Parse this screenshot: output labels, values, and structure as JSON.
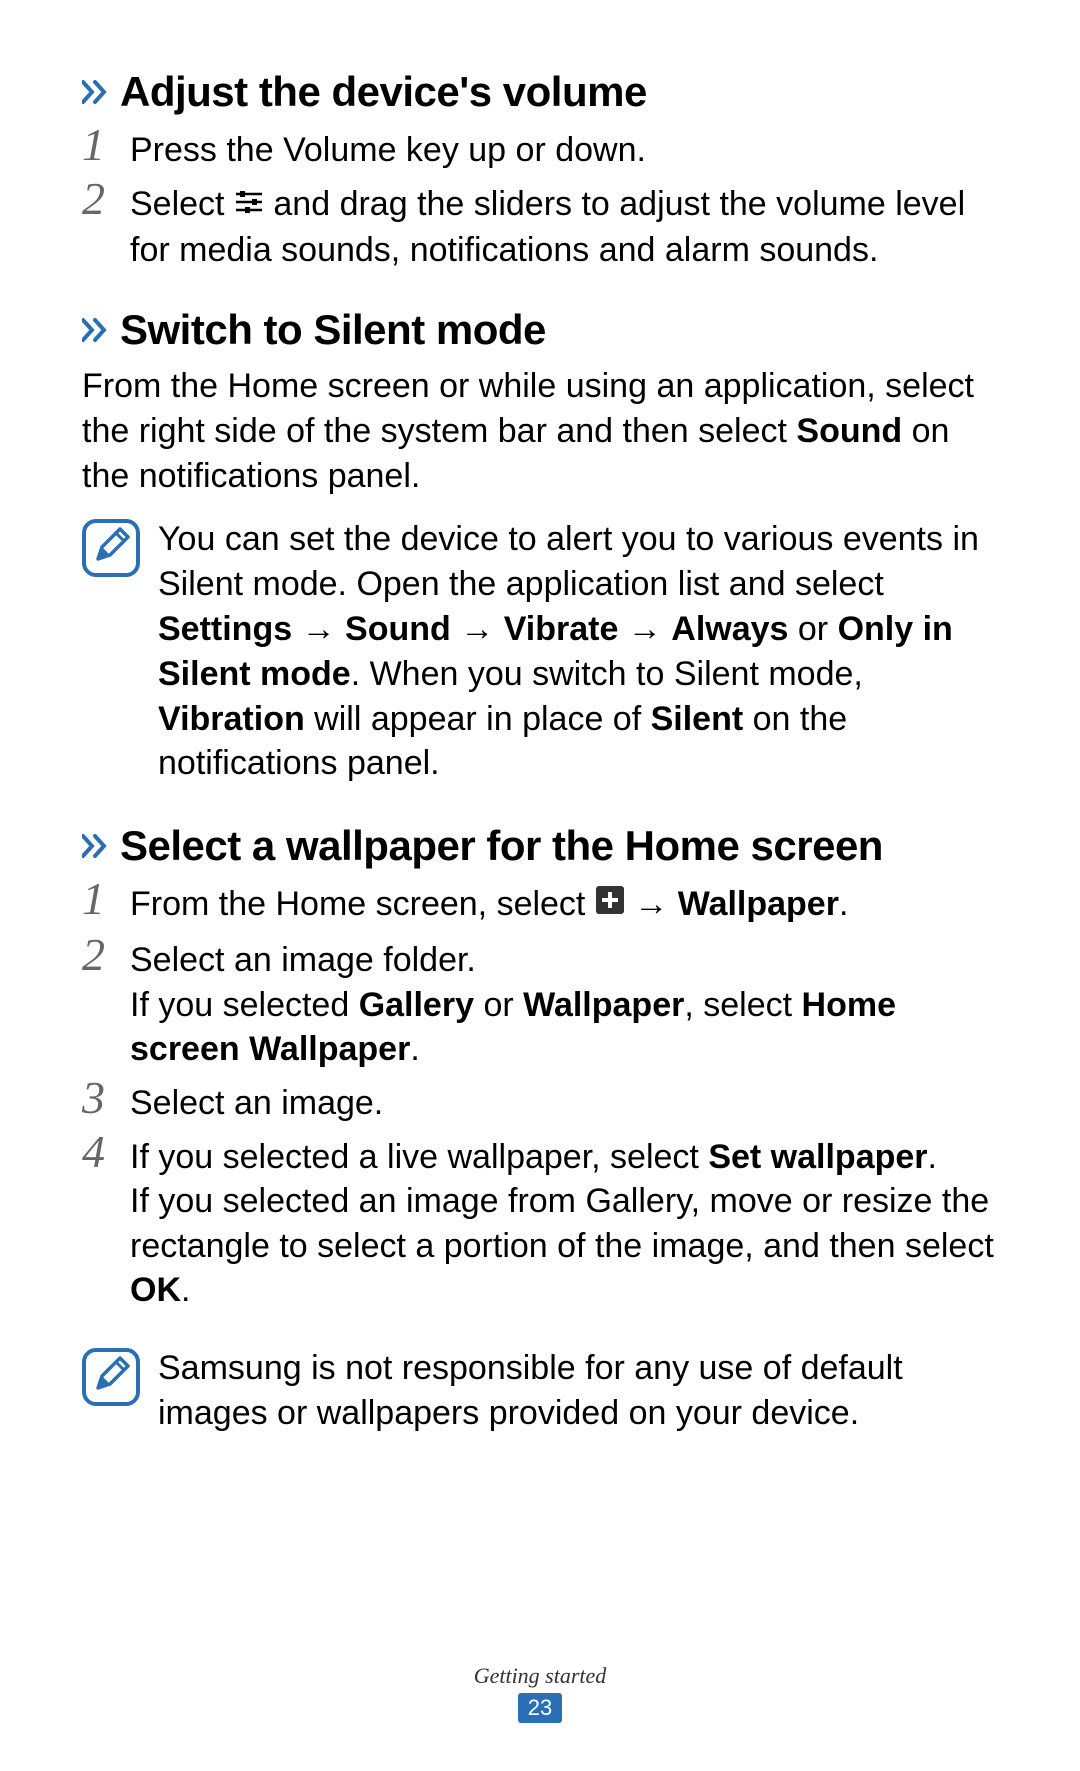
{
  "sections": {
    "volume": {
      "heading": "Adjust the device's volume",
      "steps": {
        "s1": "Press the Volume key up or down.",
        "s2_a": "Select ",
        "s2_b": " and drag the sliders to adjust the volume level for media sounds, notifications and alarm sounds."
      }
    },
    "silent": {
      "heading": "Switch to Silent mode",
      "intro_a": "From the Home screen or while using an application, select the right side of the system bar and then select ",
      "intro_b": "Sound",
      "intro_c": " on the notifications panel.",
      "note_a": "You can set the device to alert you to various events in Silent mode. Open the application list and select ",
      "note_b": "Settings",
      "note_c": "Sound",
      "note_d": "Vibrate",
      "note_e": "Always",
      "note_or": " or ",
      "note_f": "Only in Silent mode",
      "note_g": ". When you switch to Silent mode, ",
      "note_h": "Vibration",
      "note_i": " will appear in place of ",
      "note_j": "Silent",
      "note_k": " on the notifications panel."
    },
    "wallpaper": {
      "heading": "Select a wallpaper for the Home screen",
      "s1_a": "From the Home screen, select ",
      "s1_b": "Wallpaper",
      "s1_c": ".",
      "s2_a": "Select an image folder.",
      "s2_b": "If you selected ",
      "s2_c": "Gallery",
      "s2_d": " or ",
      "s2_e": "Wallpaper",
      "s2_f": ", select ",
      "s2_g": "Home screen Wallpaper",
      "s2_h": ".",
      "s3": "Select an image.",
      "s4_a": "If you selected a live wallpaper, select ",
      "s4_b": "Set wallpaper",
      "s4_c": ".",
      "s4_d": "If you selected an image from Gallery, move or resize the rectangle to select a portion of the image, and then select ",
      "s4_e": "OK",
      "s4_f": ".",
      "note": "Samsung is not responsible for any use of default images or wallpapers provided on your device."
    }
  },
  "nums": {
    "n1": "1",
    "n2": "2",
    "n3": "3",
    "n4": "4"
  },
  "arrow": " → ",
  "footer": {
    "label": "Getting started",
    "page": "23"
  }
}
